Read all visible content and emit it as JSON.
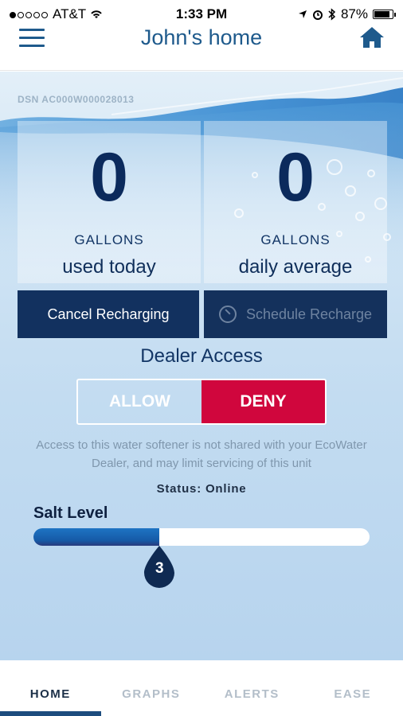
{
  "status_bar": {
    "carrier": "AT&T",
    "time": "1:33 PM",
    "battery": "87%",
    "battery_level": 0.87
  },
  "navbar": {
    "title": "John's home",
    "menu_icon": "hamburger-icon",
    "home_icon": "home-icon"
  },
  "device": {
    "dsn": "DSN AC000W000028013"
  },
  "stats": {
    "today": {
      "value": "0",
      "unit": "GALLONS",
      "label": "used today"
    },
    "average": {
      "value": "0",
      "unit": "GALLONS",
      "label": "daily average"
    }
  },
  "actions": {
    "cancel": "Cancel Recharging",
    "schedule": "Schedule Recharge",
    "schedule_icon": "clock-icon"
  },
  "dealer": {
    "title": "Dealer Access",
    "allow": "ALLOW",
    "deny": "DENY",
    "selected": "DENY",
    "note": "Access to this water softener is not shared with your EcoWater Dealer, and may limit servicing of this unit"
  },
  "status": "Status: Online",
  "salt": {
    "title": "Salt Level",
    "level": "3",
    "fill_fraction": 0.375
  },
  "tabs": [
    {
      "label": "HOME",
      "active": true
    },
    {
      "label": "GRAPHS",
      "active": false
    },
    {
      "label": "ALERTS",
      "active": false
    },
    {
      "label": "EASE",
      "active": false
    }
  ],
  "colors": {
    "primary": "#12315f",
    "accent": "#1e5a8c",
    "deny": "#d0063d",
    "salt_fill": "#1e74c4"
  }
}
